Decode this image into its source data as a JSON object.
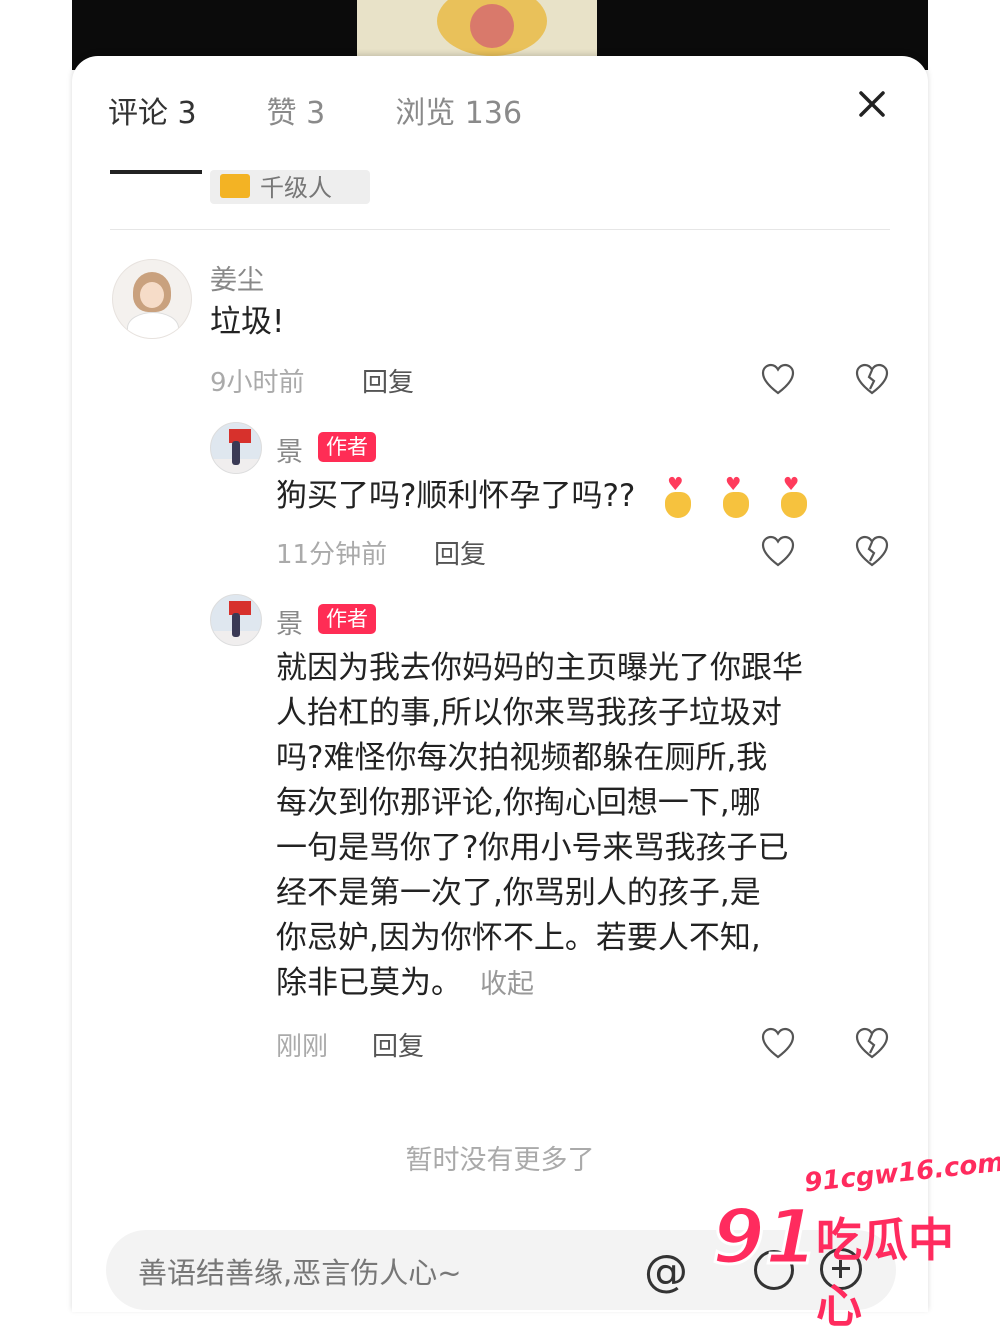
{
  "tabs": [
    {
      "label": "评论 3",
      "active": true
    },
    {
      "label": "赞 3",
      "active": false
    },
    {
      "label": "浏览 136",
      "active": false
    }
  ],
  "level_badge": "千级人",
  "comments": [
    {
      "username": "姜尘",
      "text": "垃圾!",
      "time": "9小时前",
      "reply_label": "回复"
    }
  ],
  "replies": [
    {
      "username": "景",
      "tag": "作者",
      "text": "狗买了吗?顺利怀孕了吗??",
      "emojis": [
        "🫰",
        "🫰",
        "🫰"
      ],
      "time": "11分钟前",
      "reply_label": "回复"
    },
    {
      "username": "景",
      "tag": "作者",
      "text_lines": [
        "就因为我去你妈妈的主页曝光了你跟华",
        "人抬杠的事,所以你来骂我孩子垃圾对",
        "吗?难怪你每次拍视频都躲在厕所,我",
        "每次到你那评论,你掏心回想一下,哪",
        "一句是骂你了?你用小号来骂我孩子已",
        "经不是第一次了,你骂别人的孩子,是",
        "你忌妒,因为你怀不上。若要人不知,",
        "除非已莫为。"
      ],
      "collapse_label": "收起",
      "time": "刚刚",
      "reply_label": "回复"
    }
  ],
  "no_more": "暂时没有更多了",
  "input": {
    "placeholder": "善语结善缘,恶言伤人心~",
    "at_symbol": "@"
  },
  "watermark": {
    "url": "91cgw16.com",
    "number": "91",
    "text": "吃瓜中心"
  },
  "colors": {
    "author_tag": "#ff2d55",
    "watermark": "#ff2b5e"
  }
}
